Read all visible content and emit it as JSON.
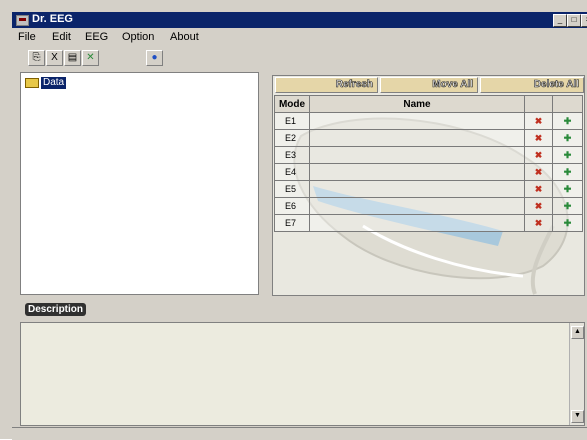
{
  "window": {
    "title": "Dr. EEG",
    "controls": {
      "minimize": "_",
      "maximize": "□",
      "close": "×"
    }
  },
  "menu": [
    "File",
    "Edit",
    "EEG",
    "Option",
    "About"
  ],
  "toolbar": {
    "icons": [
      "copy-icon",
      "cut-icon",
      "paste-icon",
      "delete-icon",
      "globe-icon"
    ],
    "glyphs": [
      "⎘",
      "X",
      "▤",
      "✕",
      "●"
    ]
  },
  "tree": {
    "root_label": "Data"
  },
  "actions": {
    "refresh": "Refresh",
    "move_all": "Move All",
    "delete_all": "Delete All"
  },
  "table": {
    "columns": [
      "Mode",
      "Name"
    ],
    "rows": [
      {
        "mode": "E1",
        "name": ""
      },
      {
        "mode": "E2",
        "name": ""
      },
      {
        "mode": "E3",
        "name": ""
      },
      {
        "mode": "E4",
        "name": ""
      },
      {
        "mode": "E5",
        "name": ""
      },
      {
        "mode": "E6",
        "name": ""
      },
      {
        "mode": "E7",
        "name": ""
      }
    ],
    "delete_glyph": "✖",
    "add_glyph": "✚"
  },
  "description": {
    "label": "Description",
    "text": ""
  },
  "colors": {
    "titlebar": "#0a246a",
    "action_button": "#e5d6a8",
    "delete": "#c03020",
    "add": "#2a8a3a"
  }
}
